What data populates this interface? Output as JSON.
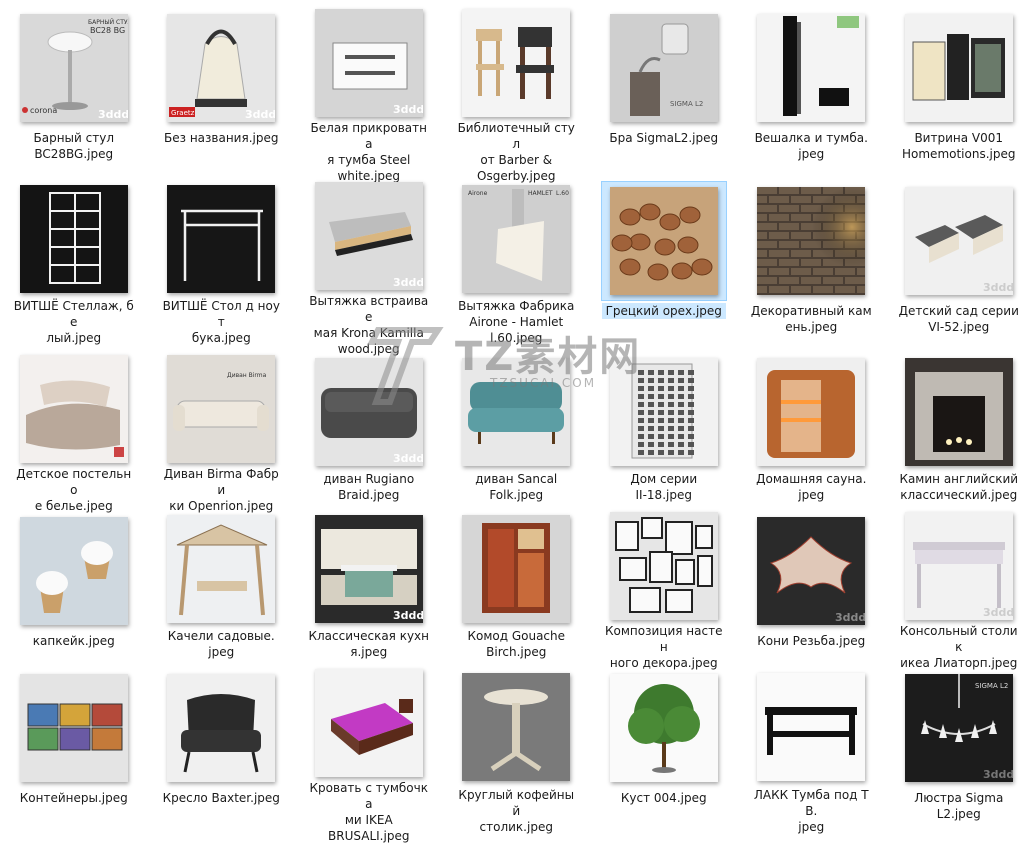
{
  "files": [
    {
      "label": "Барный стул\nBC28BG.jpeg",
      "icon": "bar-stool-thumbnail",
      "bg": "#dcdcdc"
    },
    {
      "label": "Без названия.jpeg",
      "icon": "kettle-thumbnail",
      "bg": "#e6e6e6"
    },
    {
      "label": "Белая прикроватна\nя тумба Steel\nwhite.jpeg",
      "icon": "nightstand-thumbnail",
      "bg": "#d8d8d8"
    },
    {
      "label": "Библиотечный стул\nот Barber &\nOsgerby.jpeg",
      "icon": "chairs-thumbnail",
      "bg": "#f0f0f0"
    },
    {
      "label": "Бра SigmaL2.jpeg",
      "icon": "sconce-thumbnail",
      "bg": "#cfcfcf"
    },
    {
      "label": "Вешалка и тумба.\njpeg",
      "icon": "hanger-thumbnail",
      "bg": "#f4f4f4"
    },
    {
      "label": "Витрина V001\nHomemotions.jpeg",
      "icon": "cabinet-thumbnail",
      "bg": "#f2f2f2"
    },
    {
      "label": "ВИТШЁ Стеллаж, бе\nлый.jpeg",
      "icon": "shelf-thumbnail",
      "bg": "#141414"
    },
    {
      "label": "ВИТШЁ Стол д ноут\nбука.jpeg",
      "icon": "laptop-table-thumbnail",
      "bg": "#161616"
    },
    {
      "label": "Вытяжка встраивае\nмая Krona Kamilla\nwood.jpeg",
      "icon": "hood-thumbnail",
      "bg": "#dcdcdc"
    },
    {
      "label": "Вытяжка Фабрика\nAirone - Hamlet\nl.60.jpeg",
      "icon": "hood-hamlet-thumbnail",
      "bg": "#cfcfcf"
    },
    {
      "label": "Грецкий орех.jpeg",
      "icon": "walnuts-thumbnail",
      "bg": "#c9a77a"
    },
    {
      "label": "Декоративный кам\nень.jpeg",
      "icon": "stone-thumbnail",
      "bg": "#5a4a3a"
    },
    {
      "label": "Детский сад серии\nVI-52.jpeg",
      "icon": "kindergarten-thumbnail",
      "bg": "#f0f0f0"
    },
    {
      "label": "Детское постельно\nе белье.jpeg",
      "icon": "bedding-thumbnail",
      "bg": "#f3f0ee"
    },
    {
      "label": "Диван Birma Фабри\nки Openrion.jpeg",
      "icon": "sofa-birma-thumbnail",
      "bg": "#e0dcd6"
    },
    {
      "label": "диван Rugiano\nBraid.jpeg",
      "icon": "sofa-rugiano-thumbnail",
      "bg": "#e4e4e4"
    },
    {
      "label": "диван Sancal\nFolk.jpeg",
      "icon": "sofa-sancal-thumbnail",
      "bg": "#e8e8e8"
    },
    {
      "label": "Дом серии\nII-18.jpeg",
      "icon": "building-thumbnail",
      "bg": "#f2f2f2"
    },
    {
      "label": "Домашняя сауна.\njpeg",
      "icon": "sauna-thumbnail",
      "bg": "#efefef"
    },
    {
      "label": "Камин английский\nклассический.jpeg",
      "icon": "fireplace-thumbnail",
      "bg": "#3a3532"
    },
    {
      "label": "капкейк.jpeg",
      "icon": "cupcake-thumbnail",
      "bg": "#cfd8df"
    },
    {
      "label": "Качели садовые.\njpeg",
      "icon": "swing-thumbnail",
      "bg": "#eef0f2"
    },
    {
      "label": "Классическая кухн\nя.jpeg",
      "icon": "kitchen-thumbnail",
      "bg": "#2a2a2a"
    },
    {
      "label": "Комод Gouache\nBirch.jpeg",
      "icon": "dresser-thumbnail",
      "bg": "#d6d6d6"
    },
    {
      "label": "Композиция настен\nного декора.jpeg",
      "icon": "wall-decor-thumbnail",
      "bg": "#e6e6e6"
    },
    {
      "label": "Кони Резьба.jpeg",
      "icon": "horses-carving-thumbnail",
      "bg": "#2a2a2a"
    },
    {
      "label": "Консольный столик\nикеа Лиаторп.jpeg",
      "icon": "console-table-thumbnail",
      "bg": "#f2f2f2"
    },
    {
      "label": "Контейнеры.jpeg",
      "icon": "containers-thumbnail",
      "bg": "#e4e4e4"
    },
    {
      "label": "Кресло Baxter.jpeg",
      "icon": "armchair-thumbnail",
      "bg": "#f0f0f0"
    },
    {
      "label": "Кровать с тумбочка\nми IKEA\nBRUSALI.jpeg",
      "icon": "bed-thumbnail",
      "bg": "#f3f3f3"
    },
    {
      "label": "Круглый кофейный\nстолик.jpeg",
      "icon": "coffee-table-thumbnail",
      "bg": "#7a7a7a"
    },
    {
      "label": "Куст 004.jpeg",
      "icon": "bush-thumbnail",
      "bg": "#fafafa"
    },
    {
      "label": "ЛАКК Тумба под ТВ.\njpeg",
      "icon": "tv-stand-thumbnail",
      "bg": "#fafafa"
    },
    {
      "label": "Люстра Sigma\nL2.jpeg",
      "icon": "chandelier-thumbnail",
      "bg": "#1c1c1c"
    }
  ],
  "selected_index": 11,
  "thumb_texts": {
    "bar_stool": [
      "БАРНЫЙ СТУЛ",
      "BC28 BG",
      "corona"
    ],
    "kettle": "Graetz",
    "hood_hamlet": [
      "Airone",
      "HAMLET",
      "L.60"
    ],
    "sconce": "SIGMA L2",
    "chandelier": "SIGMA L2",
    "sofa_birma": "Диван Birma",
    "watermark_3d": "3ddd"
  },
  "watermark": {
    "title": "TZ素材网",
    "sub": "TZSUCAI.COM"
  }
}
